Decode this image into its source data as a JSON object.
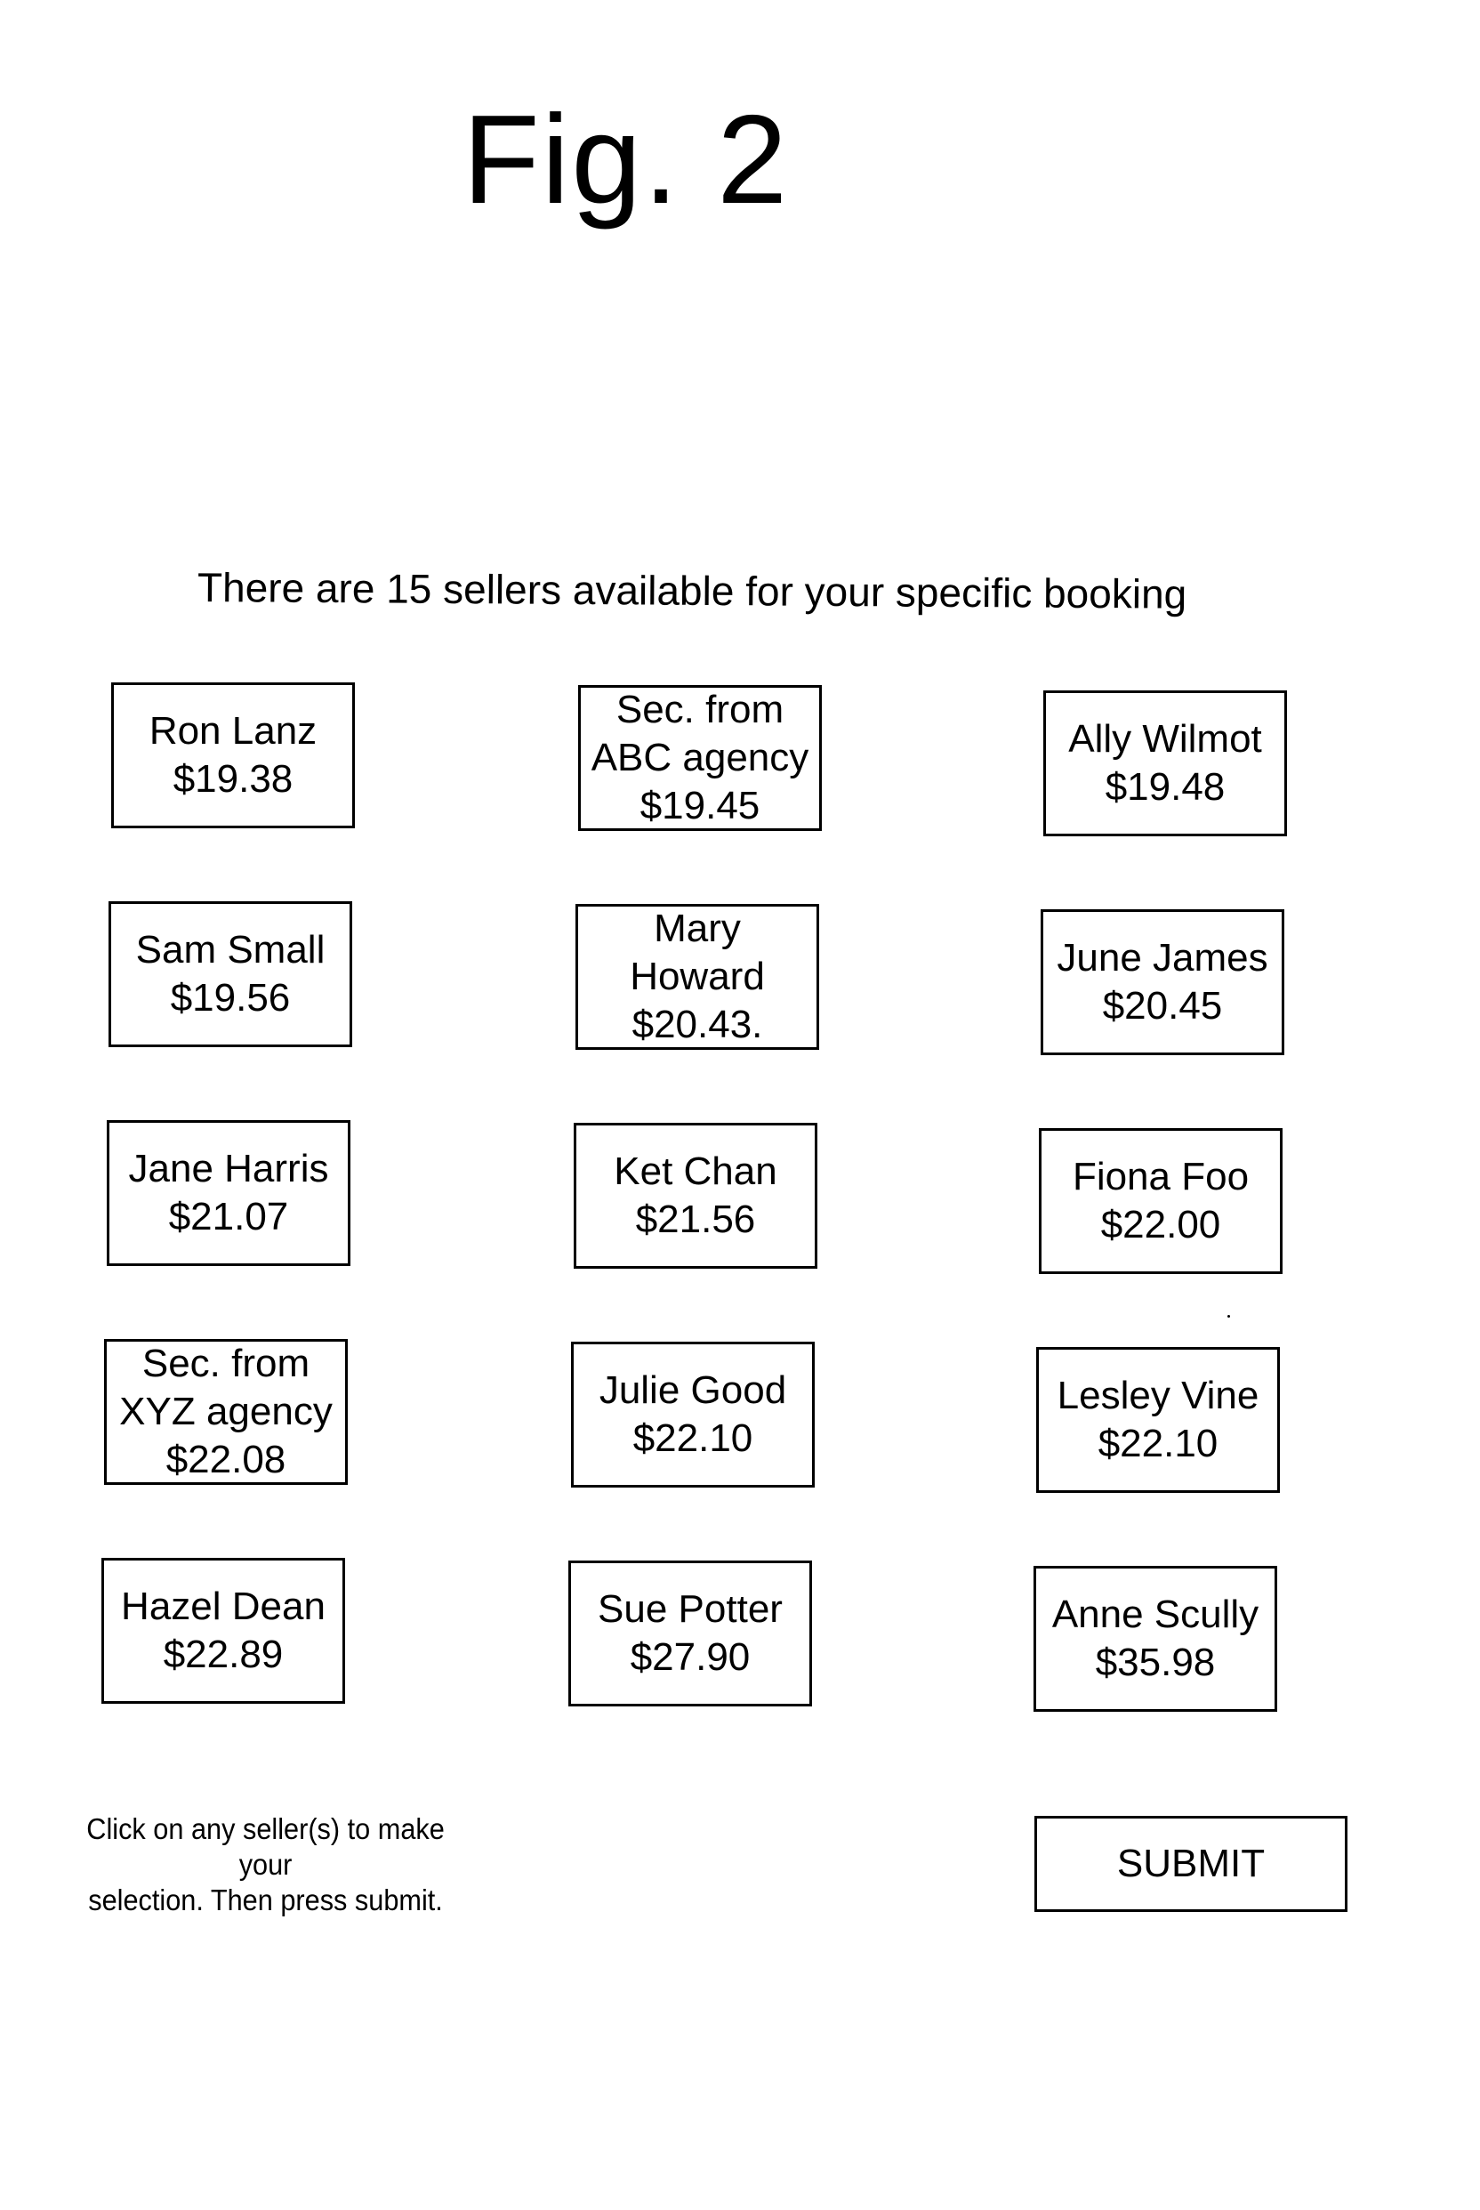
{
  "figure": {
    "title": "Fig. 2"
  },
  "header": {
    "text": "There are 15 sellers available for your specific booking",
    "seller_count": 15
  },
  "sellers": [
    {
      "lines": [
        "Ron Lanz",
        "$19.38"
      ],
      "name": "Ron Lanz",
      "price": "$19.38"
    },
    {
      "lines": [
        "Sec. from",
        "ABC agency",
        "$19.45"
      ],
      "name": "Sec. from ABC agency",
      "price": "$19.45"
    },
    {
      "lines": [
        "Ally Wilmot",
        "$19.48"
      ],
      "name": "Ally Wilmot",
      "price": "$19.48"
    },
    {
      "lines": [
        "Sam Small",
        "$19.56"
      ],
      "name": "Sam Small",
      "price": "$19.56"
    },
    {
      "lines": [
        "Mary",
        "Howard",
        "$20.43."
      ],
      "name": "Mary Howard",
      "price": "$20.43."
    },
    {
      "lines": [
        "June James",
        "$20.45"
      ],
      "name": "June James",
      "price": "$20.45"
    },
    {
      "lines": [
        "Jane Harris",
        "$21.07"
      ],
      "name": "Jane Harris",
      "price": "$21.07"
    },
    {
      "lines": [
        "Ket Chan",
        "$21.56"
      ],
      "name": "Ket Chan",
      "price": "$21.56"
    },
    {
      "lines": [
        "Fiona Foo",
        "$22.00"
      ],
      "name": "Fiona Foo",
      "price": "$22.00"
    },
    {
      "lines": [
        "Sec. from",
        "XYZ agency",
        "$22.08"
      ],
      "name": "Sec. from XYZ agency",
      "price": "$22.08"
    },
    {
      "lines": [
        "Julie Good",
        "$22.10"
      ],
      "name": "Julie Good",
      "price": "$22.10"
    },
    {
      "lines": [
        "Lesley Vine",
        "$22.10"
      ],
      "name": "Lesley Vine",
      "price": "$22.10"
    },
    {
      "lines": [
        "Hazel Dean",
        "$22.89"
      ],
      "name": "Hazel Dean",
      "price": "$22.89"
    },
    {
      "lines": [
        "Sue Potter",
        "$27.90"
      ],
      "name": "Sue Potter",
      "price": "$27.90"
    },
    {
      "lines": [
        "Anne Scully",
        "$35.98"
      ],
      "name": "Anne Scully",
      "price": "$35.98"
    }
  ],
  "footer": {
    "instructions_line1": "Click on any seller(s) to make your",
    "instructions_line2": "selection. Then press submit.",
    "submit_label": "SUBMIT"
  },
  "colors": {
    "ink": "#000000",
    "paper": "#ffffff"
  }
}
